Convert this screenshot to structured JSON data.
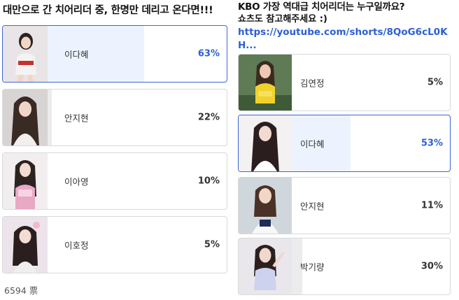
{
  "left_poll": {
    "title": "대만으로 간 치어리더 중, 한명만 데리고 온다면!!!",
    "options": [
      {
        "name": "이다혜",
        "percent": "63%",
        "fill": 0.63,
        "selected": true
      },
      {
        "name": "안지현",
        "percent": "22%",
        "fill": 0.22,
        "selected": false
      },
      {
        "name": "이아영",
        "percent": "10%",
        "fill": 0.1,
        "selected": false
      },
      {
        "name": "이호정",
        "percent": "5%",
        "fill": 0.05,
        "selected": false
      }
    ],
    "total": "6594 票"
  },
  "right_poll": {
    "title": "KBO 가장 역대급 치어리더는 누구일까요?",
    "subtitle": "쇼츠도 참고해주세요 :)",
    "link": "https://youtube.com/shorts/8QoG6cL0KH...",
    "options": [
      {
        "name": "김연정",
        "percent": "5%",
        "fill": 0.05,
        "selected": false
      },
      {
        "name": "이다혜",
        "percent": "53%",
        "fill": 0.53,
        "selected": true
      },
      {
        "name": "안지현",
        "percent": "11%",
        "fill": 0.11,
        "selected": false
      },
      {
        "name": "박기량",
        "percent": "30%",
        "fill": 0.3,
        "selected": false
      }
    ]
  },
  "colors": {
    "selected_border": "#3b67d6",
    "selected_fill": "#edf3fe",
    "link": "#2d5fd4",
    "unselected_fill": "#ececec"
  }
}
